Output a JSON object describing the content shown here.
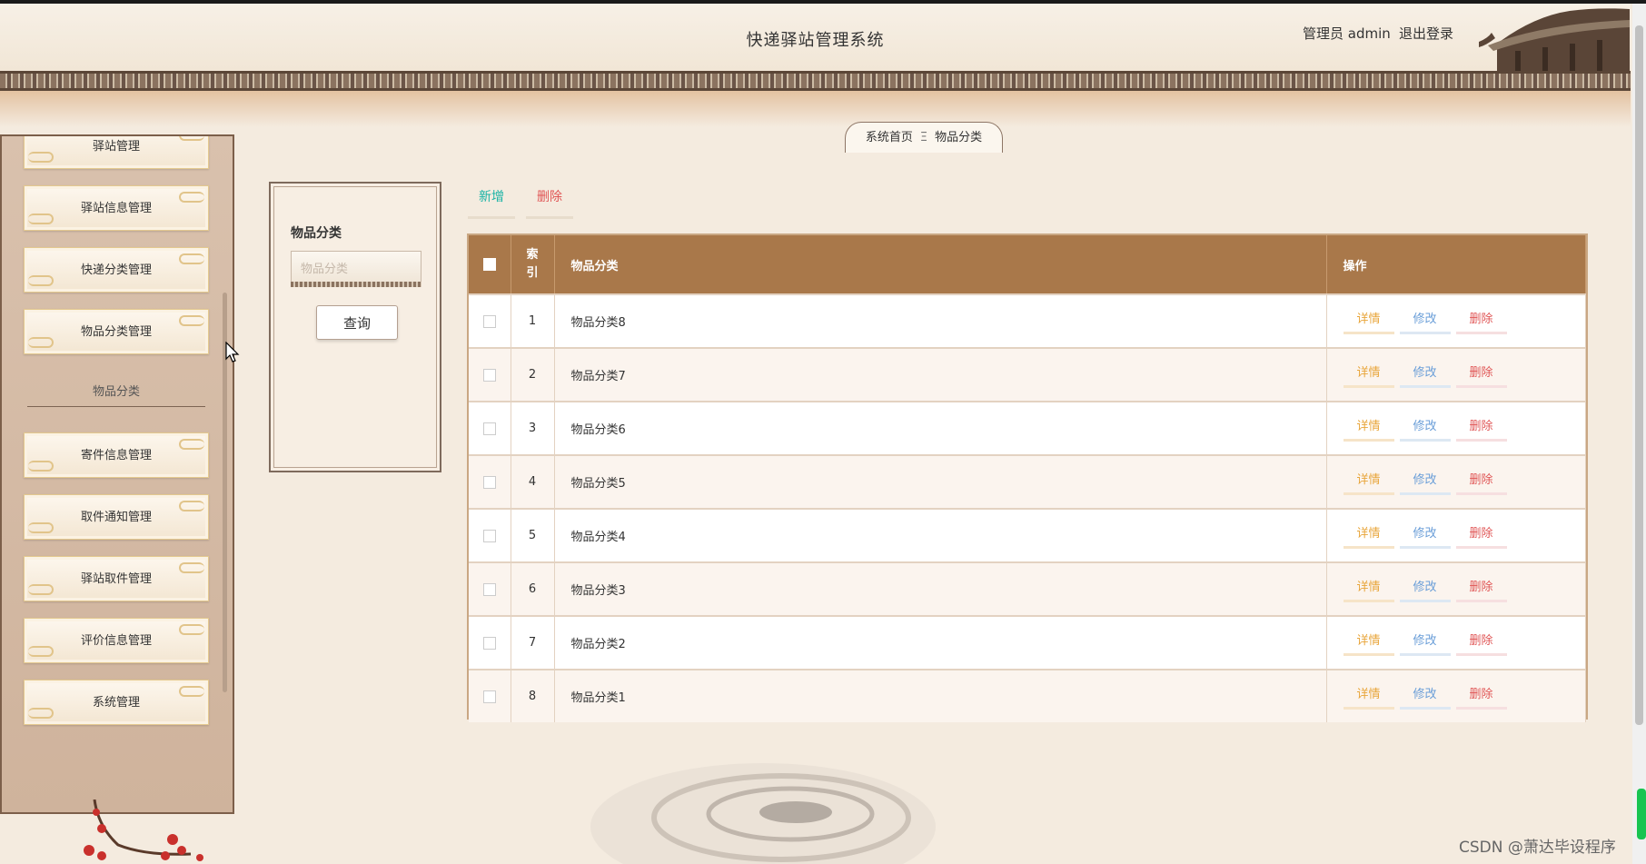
{
  "header": {
    "title": "快递驿站管理系统",
    "admin_label": "管理员 admin",
    "logout_label": "退出登录"
  },
  "sidebar": {
    "items_top": [
      {
        "label": "驿站管理"
      },
      {
        "label": "驿站信息管理"
      },
      {
        "label": "快递分类管理"
      },
      {
        "label": "物品分类管理"
      }
    ],
    "section_label": "物品分类",
    "items_bottom": [
      {
        "label": "寄件信息管理"
      },
      {
        "label": "取件通知管理"
      },
      {
        "label": "驿站取件管理"
      },
      {
        "label": "评价信息管理"
      },
      {
        "label": "系统管理"
      }
    ]
  },
  "breadcrumb": {
    "home": "系统首页",
    "separator": "Ξ",
    "current": "物品分类"
  },
  "search": {
    "label": "物品分类",
    "placeholder": "物品分类",
    "button": "查询"
  },
  "toolbar": {
    "add_label": "新增",
    "delete_label": "删除"
  },
  "table": {
    "headers": {
      "index": "索引",
      "name": "物品分类",
      "actions": "操作"
    },
    "actions": {
      "detail": "详情",
      "edit": "修改",
      "delete": "删除"
    },
    "rows": [
      {
        "index": "1",
        "name": "物品分类8"
      },
      {
        "index": "2",
        "name": "物品分类7"
      },
      {
        "index": "3",
        "name": "物品分类6"
      },
      {
        "index": "4",
        "name": "物品分类5"
      },
      {
        "index": "5",
        "name": "物品分类4"
      },
      {
        "index": "6",
        "name": "物品分类3"
      },
      {
        "index": "7",
        "name": "物品分类2"
      },
      {
        "index": "8",
        "name": "物品分类1"
      }
    ]
  },
  "watermark": "CSDN @萧达毕设程序",
  "colors": {
    "table_header": "#a9784a",
    "add": "#1ab3a6",
    "delete": "#e05656",
    "detail": "#e8a53a",
    "edit": "#6a9ed8"
  }
}
